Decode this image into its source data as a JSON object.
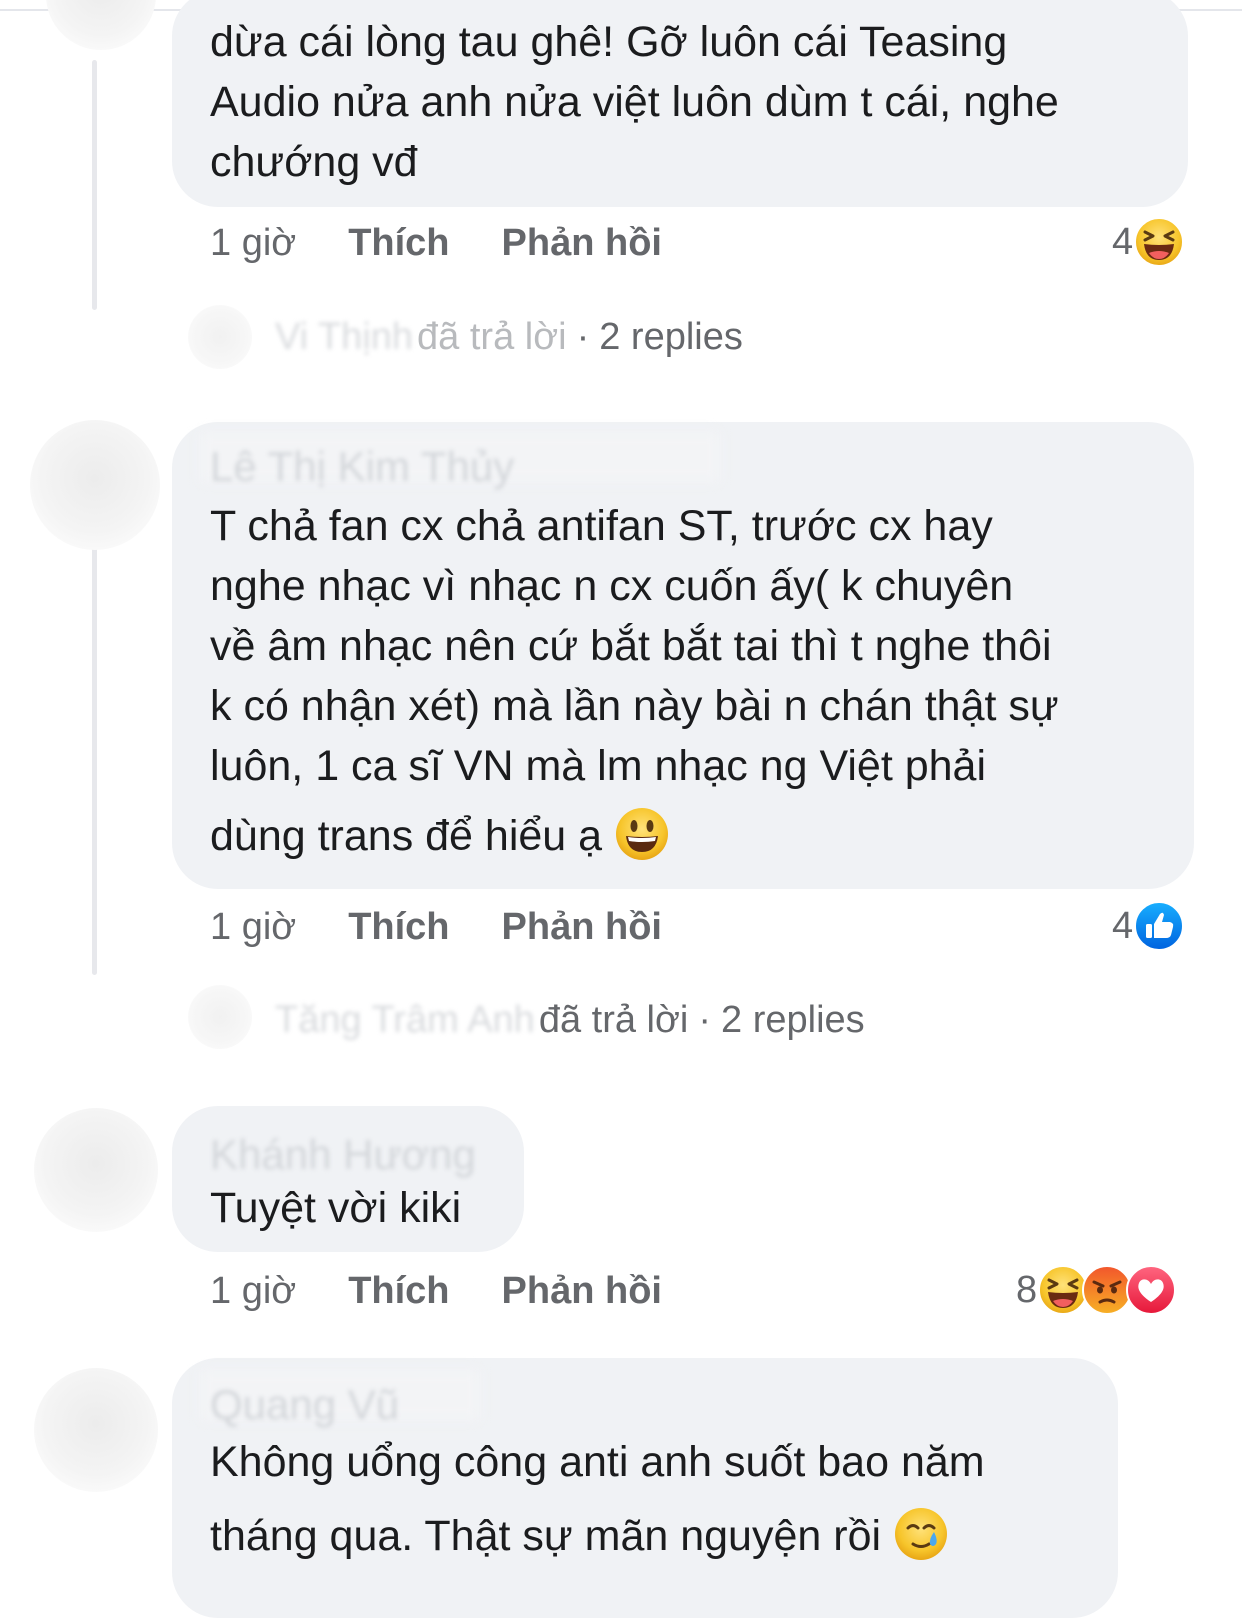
{
  "comments": [
    {
      "author": "",
      "lines": [
        "dừa cái lòng tau ghê! Gỡ luôn cái Teasing",
        "Audio nửa anh nửa việt luôn dùm t cái, nghe",
        "chướng vđ"
      ],
      "time": "1 giờ",
      "like_label": "Thích",
      "reply_label": "Phản hồi",
      "reaction_count": "4",
      "reactions": [
        "haha-icon"
      ],
      "replies": {
        "replier": "Vi Thịnh",
        "text": "đã trả lời",
        "sep": "·",
        "count_label": "2 replies"
      }
    },
    {
      "author": "Lê Thị Kim Thủy",
      "lines": [
        "T chả fan cx chả antifan ST, trước cx hay",
        "nghe nhạc vì nhạc n cx cuốn ấy( k chuyên",
        "về âm nhạc nên cứ bắt bắt tai thì t nghe thôi",
        "k có nhận xét) mà lần này bài n chán thật sự",
        "luôn, 1 ca sĩ VN mà lm nhạc ng Việt phải",
        "dùng trans để hiểu ạ"
      ],
      "trailing_emoji": "smiley-icon",
      "time": "1 giờ",
      "like_label": "Thích",
      "reply_label": "Phản hồi",
      "reaction_count": "4",
      "reactions": [
        "like-icon"
      ],
      "replies": {
        "replier": "Tăng Trâm Anh",
        "text": "đã trả lời",
        "sep": "·",
        "count_label": "2 replies"
      }
    },
    {
      "author": "Khánh Hương",
      "lines": [
        "Tuyệt vời kiki"
      ],
      "time": "1 giờ",
      "like_label": "Thích",
      "reply_label": "Phản hồi",
      "reaction_count": "8",
      "reactions": [
        "haha-icon",
        "angry-icon",
        "love-icon"
      ]
    },
    {
      "author": "Quang Vũ",
      "lines": [
        "Không uổng công anti anh suốt bao năm",
        "tháng qua. Thật sự mãn nguyện rồi"
      ],
      "trailing_emoji": "crying-smile-icon"
    }
  ],
  "colors": {
    "bubble": "#f0f2f5",
    "meta_text": "#65676b",
    "like_blue": "#1877f2",
    "love_red": "#f33e58",
    "angry_orange": "#e9710f",
    "emoji_yellow": "#f7c52b"
  }
}
